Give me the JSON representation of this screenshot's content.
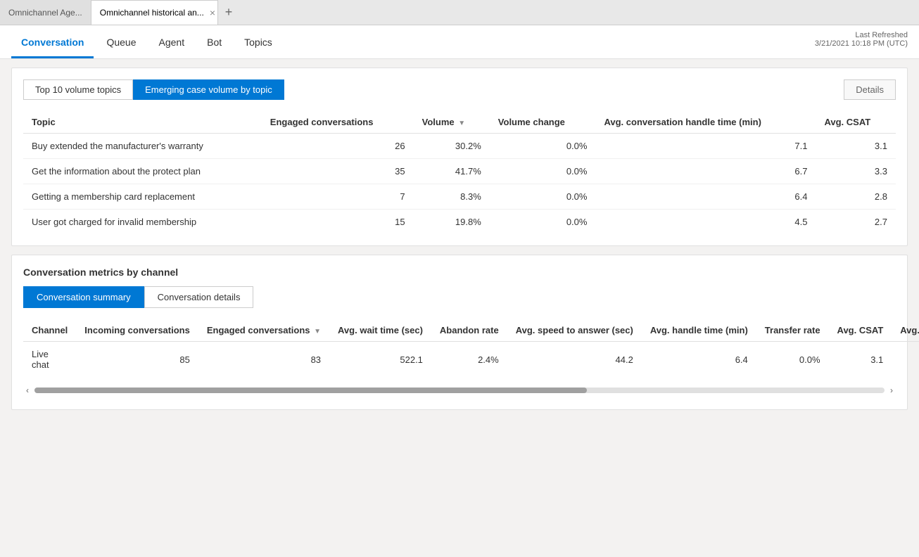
{
  "browser": {
    "tab1_label": "Omnichannel Age...",
    "tab2_label": "Omnichannel historical an...",
    "tab_new_label": "+",
    "tab_close_label": "×"
  },
  "nav": {
    "items": [
      {
        "label": "Conversation",
        "active": true
      },
      {
        "label": "Queue",
        "active": false
      },
      {
        "label": "Agent",
        "active": false
      },
      {
        "label": "Bot",
        "active": false
      },
      {
        "label": "Topics",
        "active": false
      }
    ],
    "last_refreshed_label": "Last Refreshed",
    "last_refreshed_value": "3/21/2021 10:18 PM (UTC)"
  },
  "topics_section": {
    "tab1_label": "Top 10 volume topics",
    "tab2_label": "Emerging case volume by topic",
    "details_label": "Details",
    "columns": {
      "topic": "Topic",
      "engaged_conversations": "Engaged conversations",
      "volume": "Volume",
      "volume_change": "Volume change",
      "avg_handle_time": "Avg. conversation handle time (min)",
      "avg_csat": "Avg. CSAT"
    },
    "rows": [
      {
        "topic": "Buy extended the manufacturer's warranty",
        "engaged_conversations": "26",
        "volume": "30.2%",
        "volume_change": "0.0%",
        "avg_handle_time": "7.1",
        "avg_csat": "3.1"
      },
      {
        "topic": "Get the information about the protect plan",
        "engaged_conversations": "35",
        "volume": "41.7%",
        "volume_change": "0.0%",
        "avg_handle_time": "6.7",
        "avg_csat": "3.3"
      },
      {
        "topic": "Getting a membership card replacement",
        "engaged_conversations": "7",
        "volume": "8.3%",
        "volume_change": "0.0%",
        "avg_handle_time": "6.4",
        "avg_csat": "2.8"
      },
      {
        "topic": "User got charged for invalid membership",
        "engaged_conversations": "15",
        "volume": "19.8%",
        "volume_change": "0.0%",
        "avg_handle_time": "4.5",
        "avg_csat": "2.7"
      }
    ]
  },
  "metrics_section": {
    "section_title": "Conversation metrics by channel",
    "tab1_label": "Conversation summary",
    "tab2_label": "Conversation details",
    "columns": {
      "channel": "Channel",
      "incoming": "Incoming conversations",
      "engaged": "Engaged conversations",
      "avg_wait": "Avg. wait time (sec)",
      "abandon_rate": "Abandon rate",
      "avg_speed": "Avg. speed to answer (sec)",
      "avg_handle": "Avg. handle time (min)",
      "transfer_rate": "Transfer rate",
      "avg_csat": "Avg. CSAT",
      "avg_survey": "Avg. survey se"
    },
    "rows": [
      {
        "channel": "Live chat",
        "incoming": "85",
        "engaged": "83",
        "avg_wait": "522.1",
        "abandon_rate": "2.4%",
        "avg_speed": "44.2",
        "avg_handle": "6.4",
        "transfer_rate": "0.0%",
        "avg_csat": "3.1",
        "avg_survey": ""
      }
    ]
  }
}
